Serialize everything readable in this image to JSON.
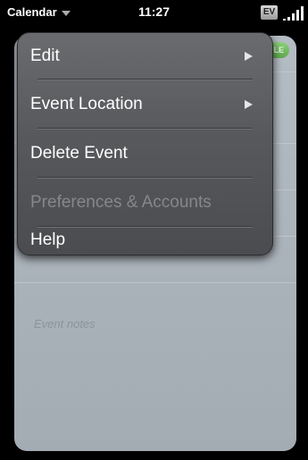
{
  "status_bar": {
    "app_title": "Calendar",
    "app_title_chevron": "chevron-down-icon",
    "time": "11:27",
    "network_badge": "EV",
    "signal_icon": "signal-strength-icon"
  },
  "event_card": {
    "pill_label": "GLE",
    "pill_color": "#6fbb5e",
    "notes_placeholder": "Event notes"
  },
  "app_menu": {
    "items": [
      {
        "label": "Edit",
        "has_submenu": true,
        "enabled": true
      },
      {
        "label": "Event Location",
        "has_submenu": true,
        "enabled": true
      },
      {
        "label": "Delete Event",
        "has_submenu": false,
        "enabled": true
      },
      {
        "label": "Preferences & Accounts",
        "has_submenu": false,
        "enabled": false
      },
      {
        "label": "Help",
        "has_submenu": false,
        "enabled": true
      }
    ]
  }
}
